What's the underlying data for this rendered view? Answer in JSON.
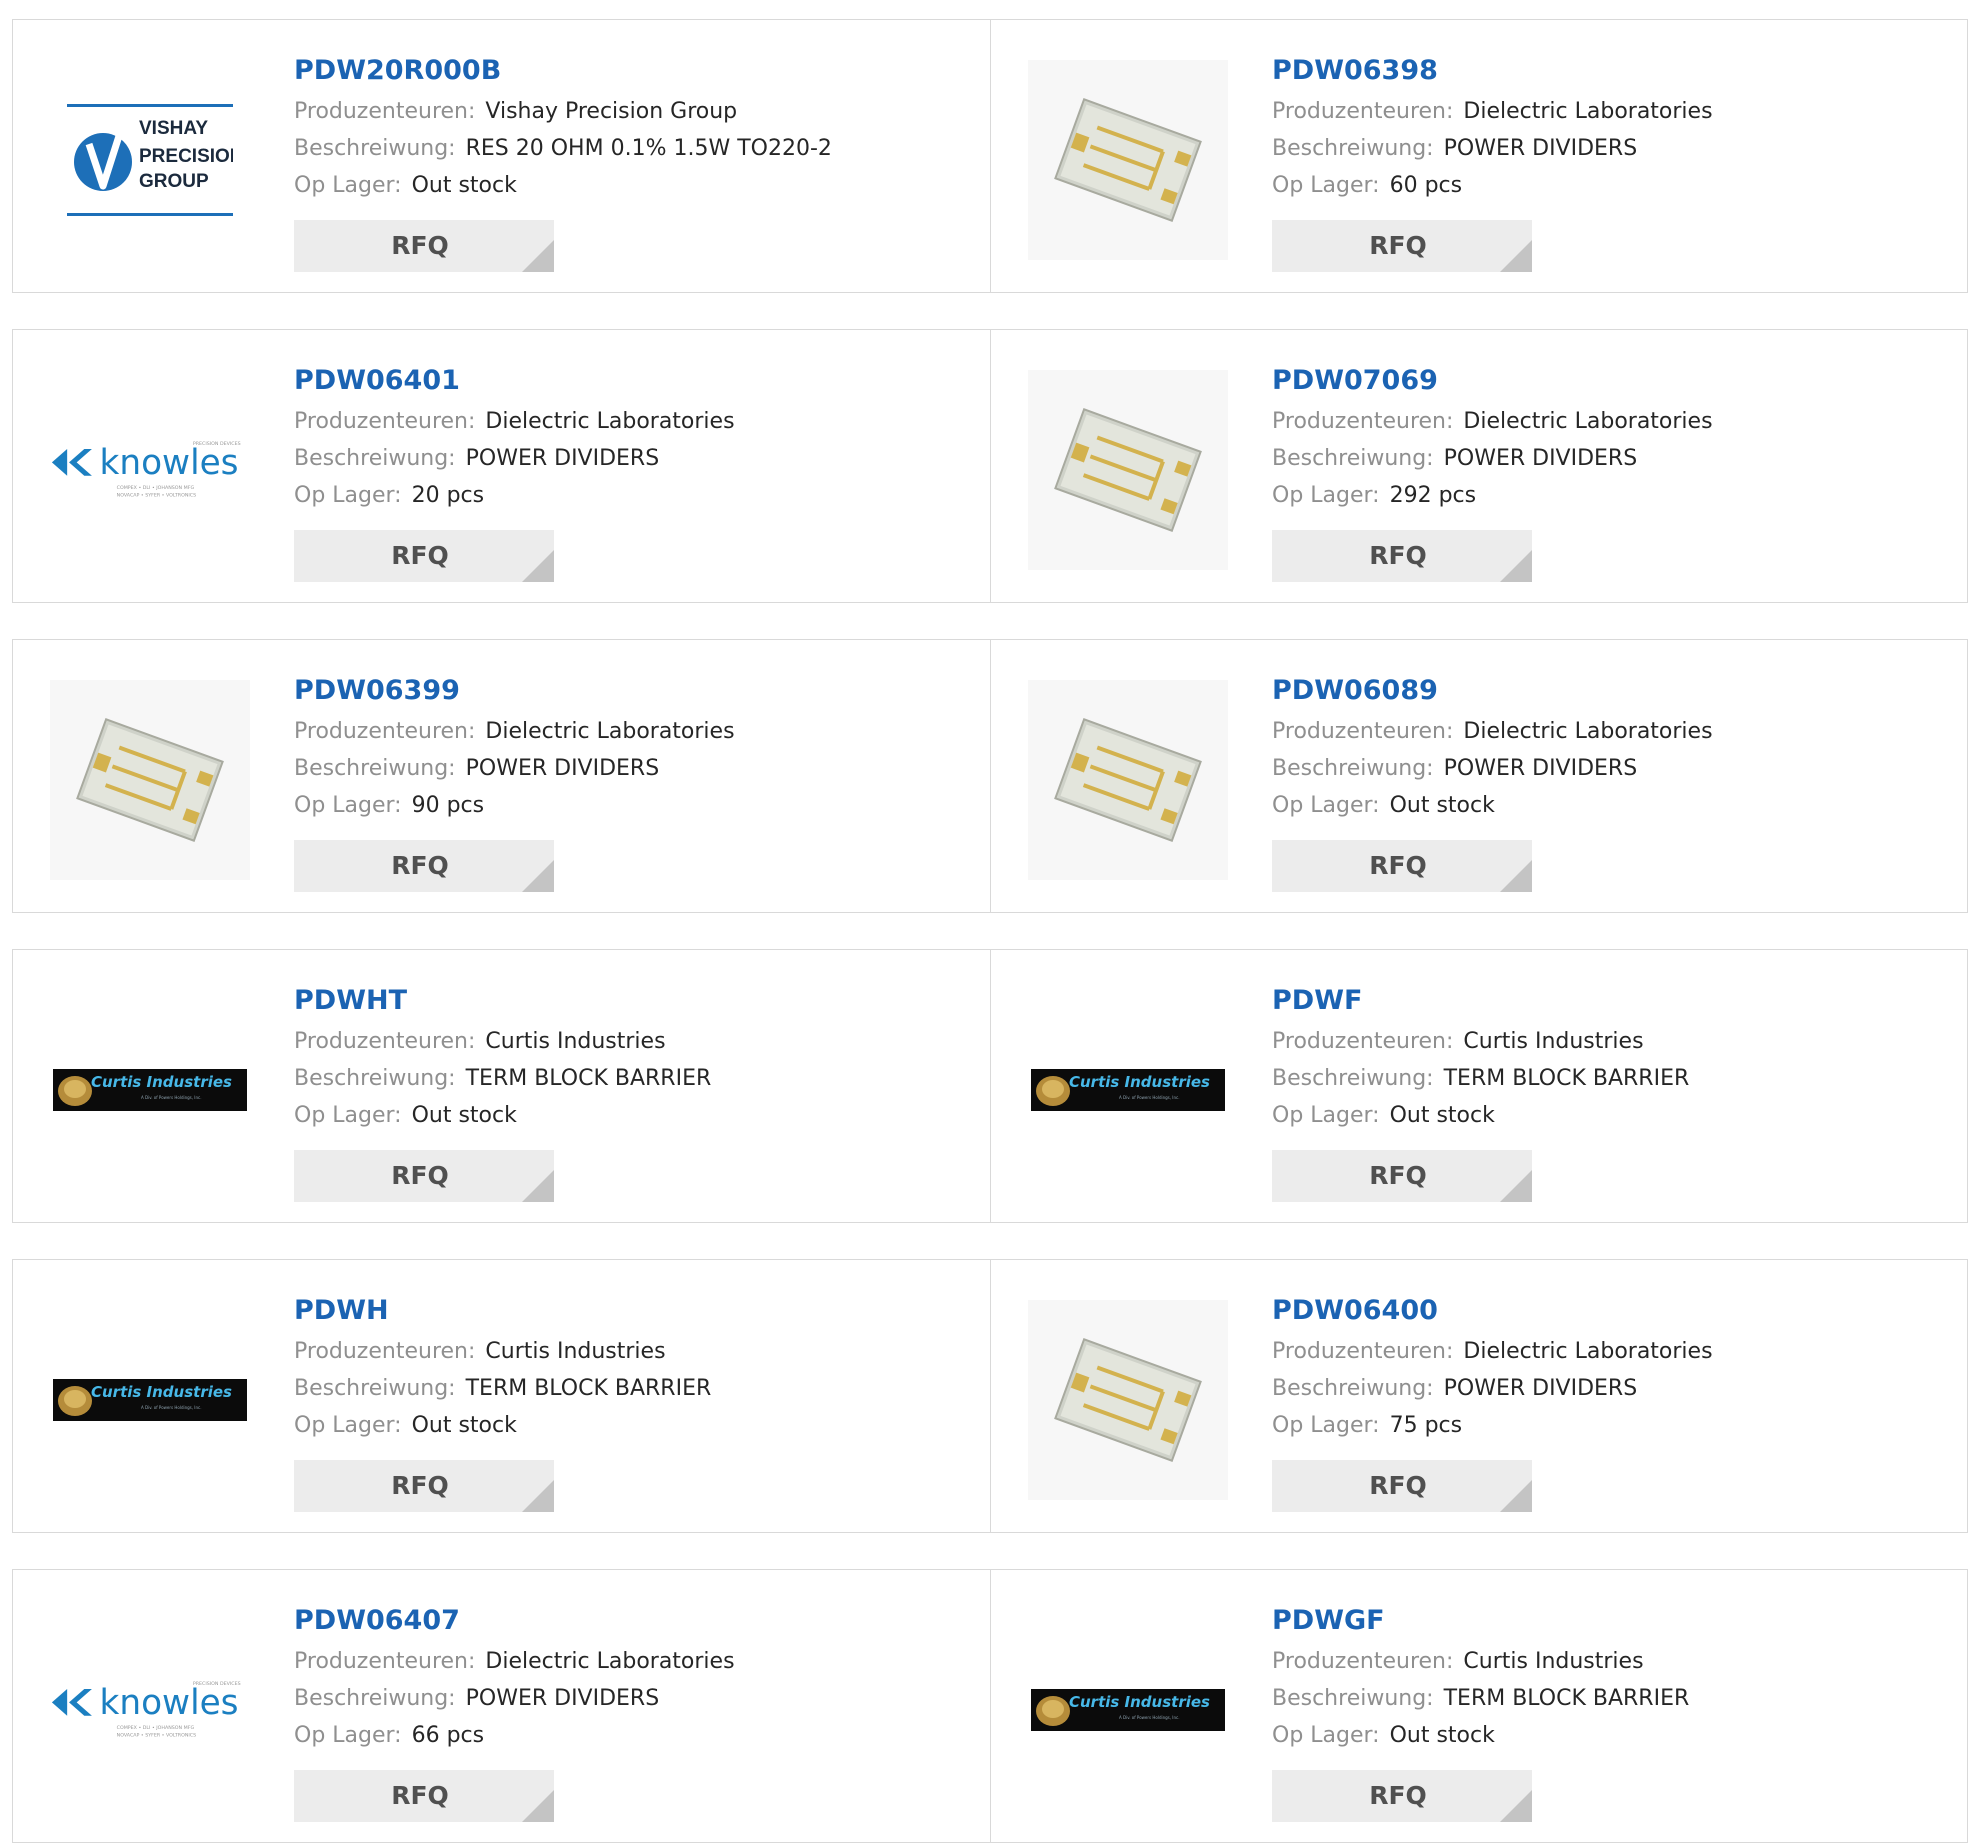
{
  "labels": {
    "manufacturer": "Produzenteuren:",
    "description": "Beschreiwung:",
    "stock": "Op Lager:",
    "rfq": "RFQ"
  },
  "logos": {
    "vishay": {
      "line1": "VISHAY",
      "line2": "PRECISION",
      "line3": "GROUP"
    },
    "knowles": {
      "name": "knowles",
      "tag": "PRECISION DEVICES",
      "sub1": "COMPEX • DLI • JOHANSON MFG",
      "sub2": "NOVACAP • SYFER • VOLTRONICS"
    },
    "curtis": {
      "name": "Curtis Industries",
      "sub": "A Div. of Powers Holdings, Inc."
    }
  },
  "products": [
    {
      "part": "PDW20R000B",
      "manufacturer": "Vishay Precision Group",
      "description": "RES 20 OHM 0.1% 1.5W TO220-2",
      "stock": "Out stock",
      "image": "vishay-logo"
    },
    {
      "part": "PDW06398",
      "manufacturer": "Dielectric Laboratories",
      "description": "POWER DIVIDERS",
      "stock": "60 pcs",
      "image": "chip-photo"
    },
    {
      "part": "PDW06401",
      "manufacturer": "Dielectric Laboratories",
      "description": "POWER DIVIDERS",
      "stock": "20 pcs",
      "image": "knowles-logo"
    },
    {
      "part": "PDW07069",
      "manufacturer": "Dielectric Laboratories",
      "description": "POWER DIVIDERS",
      "stock": "292 pcs",
      "image": "chip-photo"
    },
    {
      "part": "PDW06399",
      "manufacturer": "Dielectric Laboratories",
      "description": "POWER DIVIDERS",
      "stock": "90 pcs",
      "image": "chip-photo"
    },
    {
      "part": "PDW06089",
      "manufacturer": "Dielectric Laboratories",
      "description": "POWER DIVIDERS",
      "stock": "Out stock",
      "image": "chip-photo"
    },
    {
      "part": "PDWHT",
      "manufacturer": "Curtis Industries",
      "description": "TERM BLOCK BARRIER",
      "stock": "Out stock",
      "image": "curtis-logo"
    },
    {
      "part": "PDWF",
      "manufacturer": "Curtis Industries",
      "description": "TERM BLOCK BARRIER",
      "stock": "Out stock",
      "image": "curtis-logo"
    },
    {
      "part": "PDWH",
      "manufacturer": "Curtis Industries",
      "description": "TERM BLOCK BARRIER",
      "stock": "Out stock",
      "image": "curtis-logo"
    },
    {
      "part": "PDW06400",
      "manufacturer": "Dielectric Laboratories",
      "description": "POWER DIVIDERS",
      "stock": "75 pcs",
      "image": "chip-photo"
    },
    {
      "part": "PDW06407",
      "manufacturer": "Dielectric Laboratories",
      "description": "POWER DIVIDERS",
      "stock": "66 pcs",
      "image": "knowles-logo"
    },
    {
      "part": "PDWGF",
      "manufacturer": "Curtis Industries",
      "description": "TERM BLOCK BARRIER",
      "stock": "Out stock",
      "image": "curtis-logo"
    }
  ],
  "colors": {
    "part_link": "#1b63b3",
    "label": "#8f8f8f",
    "value": "#262626",
    "rfq_bg": "#ececec",
    "border": "#d9d9d9"
  }
}
